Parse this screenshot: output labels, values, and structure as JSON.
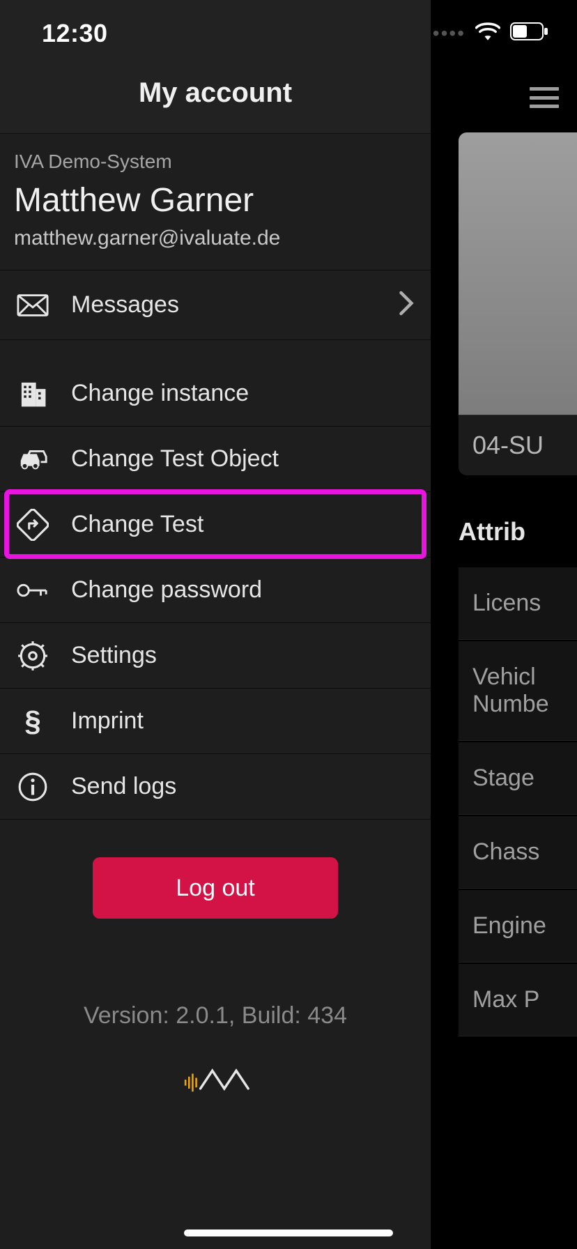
{
  "status": {
    "time": "12:30"
  },
  "drawer": {
    "title": "My account",
    "system_label": "IVA Demo-System",
    "user_name": "Matthew Garner",
    "user_email": "matthew.garner@ivaluate.de",
    "items": {
      "messages": "Messages",
      "change_instance": "Change instance",
      "change_test_object": "Change Test Object",
      "change_test": "Change Test",
      "change_password": "Change password",
      "settings": "Settings",
      "imprint": "Imprint",
      "send_logs": "Send logs"
    },
    "logout": "Log out",
    "version": "Version: 2.0.1, Build: 434"
  },
  "background": {
    "card_label": "04-SU",
    "section_title": "Attrib",
    "attrs": [
      "Licens",
      "Vehicl\nNumbe",
      "Stage",
      "Chass",
      "Engine",
      "Max P"
    ]
  }
}
